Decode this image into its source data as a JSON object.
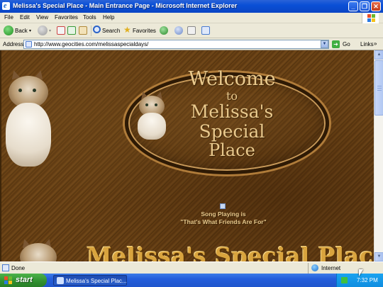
{
  "window": {
    "title": "Melissa's Special Place - Main Entrance Page - Microsoft Internet Explorer",
    "minimize": "_",
    "maximize": "❐",
    "close": "✕"
  },
  "menu": {
    "items": [
      "File",
      "Edit",
      "View",
      "Favorites",
      "Tools",
      "Help"
    ]
  },
  "toolbar": {
    "back_label": "Back",
    "search_label": "Search",
    "favorites_label": "Favorites"
  },
  "address": {
    "label": "Address",
    "url": "http://www.geocities.com/melissaspecialdays/",
    "go_label": "Go",
    "links_label": "Links"
  },
  "page": {
    "welcome_line1": "Welcome",
    "welcome_line2": "to",
    "welcome_line3": "Melissa's Special",
    "welcome_line4": "Place",
    "song_line1": "Song Playing is",
    "song_line2": "\"That's What Friends Are For\"",
    "big_title": "Melissa's Special Place"
  },
  "status": {
    "text": "Done",
    "zone": "Internet"
  },
  "taskbar": {
    "start_label": "start",
    "task_label": "Melissa's Special Plac...",
    "clock": "7:32 PM"
  }
}
